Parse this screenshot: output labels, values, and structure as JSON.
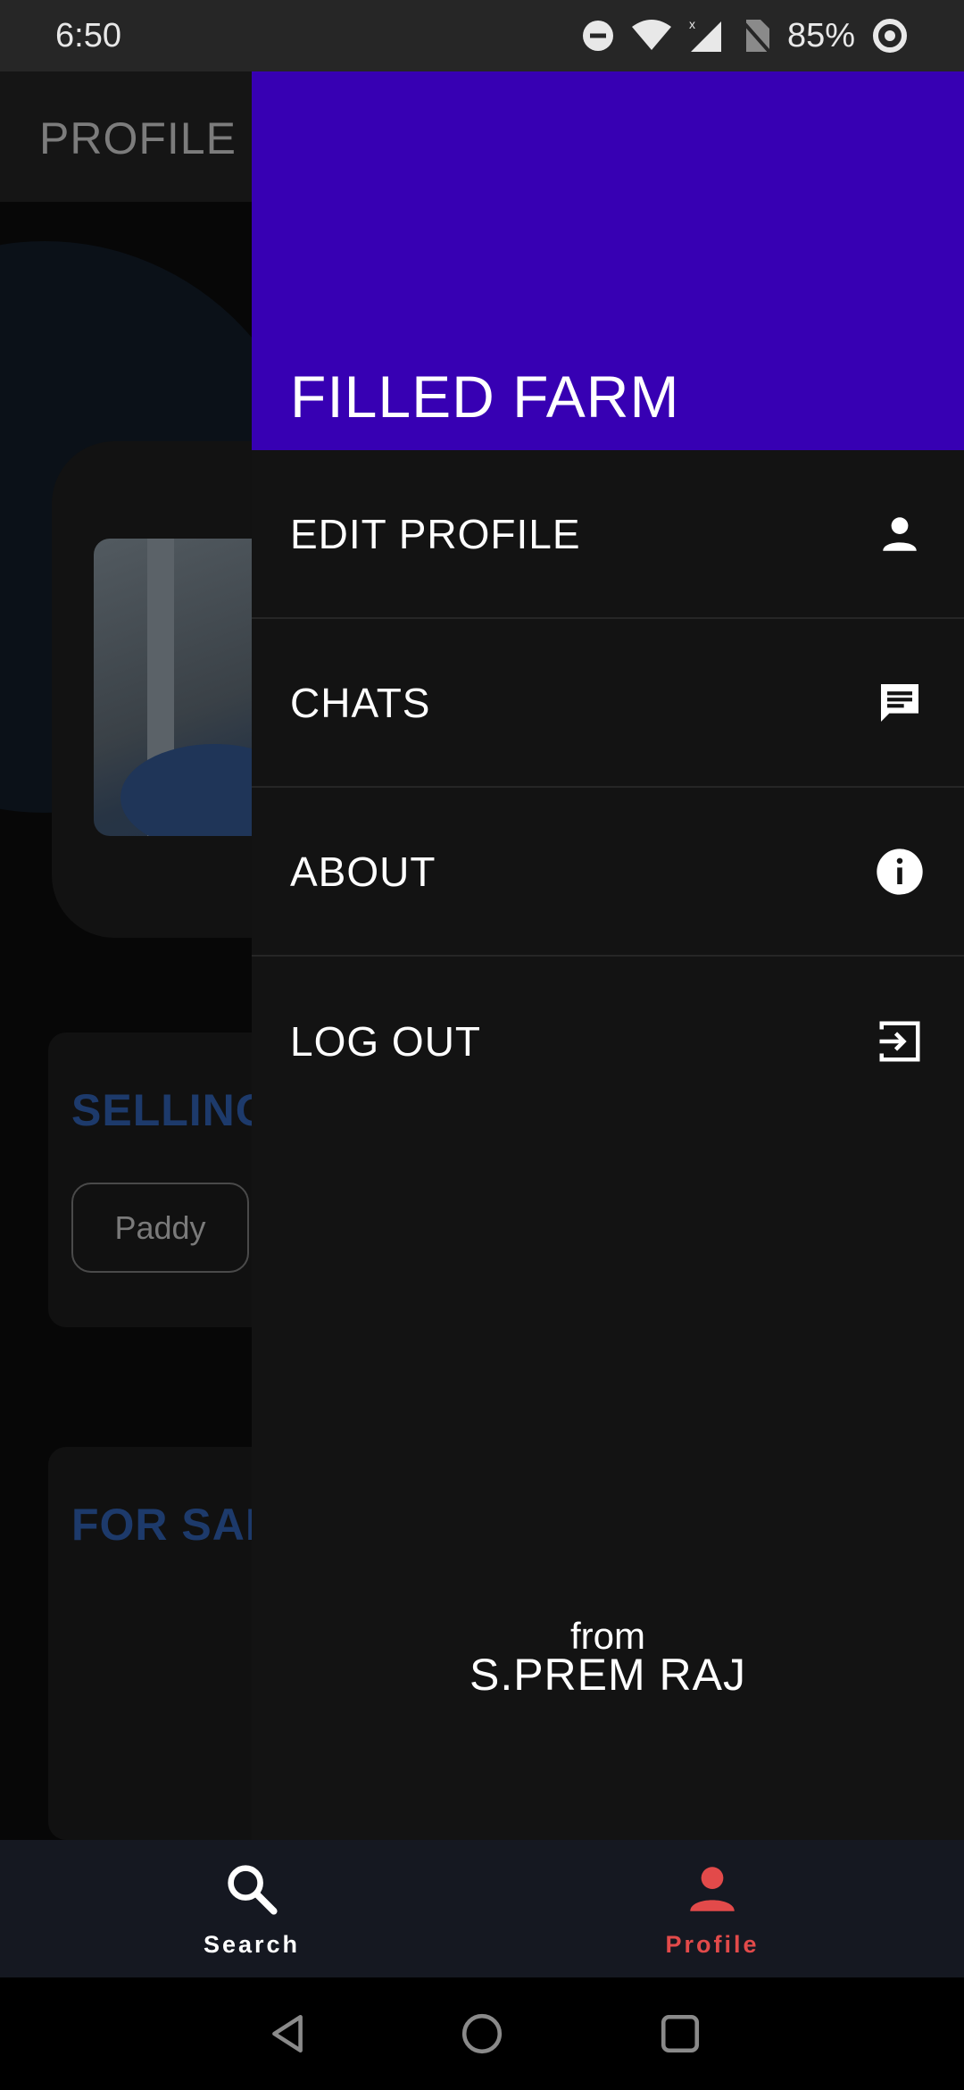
{
  "status_bar": {
    "time": "6:50",
    "battery": "85%",
    "icons": [
      "do-not-disturb-icon",
      "wifi-icon",
      "cell-signal-icon",
      "no-sim-icon",
      "battery-ring-icon"
    ]
  },
  "background_app": {
    "title": "PROFILE",
    "sections": [
      {
        "title": "SELLING"
      },
      {
        "title": "FOR SALE"
      }
    ],
    "chips": [
      "Paddy"
    ]
  },
  "drawer": {
    "brand": "FILLED FARM",
    "items": [
      {
        "label": "EDIT PROFILE",
        "icon": "person-icon"
      },
      {
        "label": "CHATS",
        "icon": "chat-icon"
      },
      {
        "label": "ABOUT",
        "icon": "info-icon"
      },
      {
        "label": "LOG OUT",
        "icon": "logout-icon"
      }
    ],
    "credit": {
      "from": "from",
      "name": "S.PREM RAJ"
    },
    "header_color": "#3700b3"
  },
  "bottom_nav": {
    "items": [
      {
        "label": "Search",
        "icon": "search-icon",
        "active": false
      },
      {
        "label": "Profile",
        "icon": "person-icon",
        "active": true
      }
    ],
    "active_color": "#e24a4a"
  },
  "system_nav": {
    "buttons": [
      "back-icon",
      "home-icon",
      "recents-icon"
    ]
  }
}
